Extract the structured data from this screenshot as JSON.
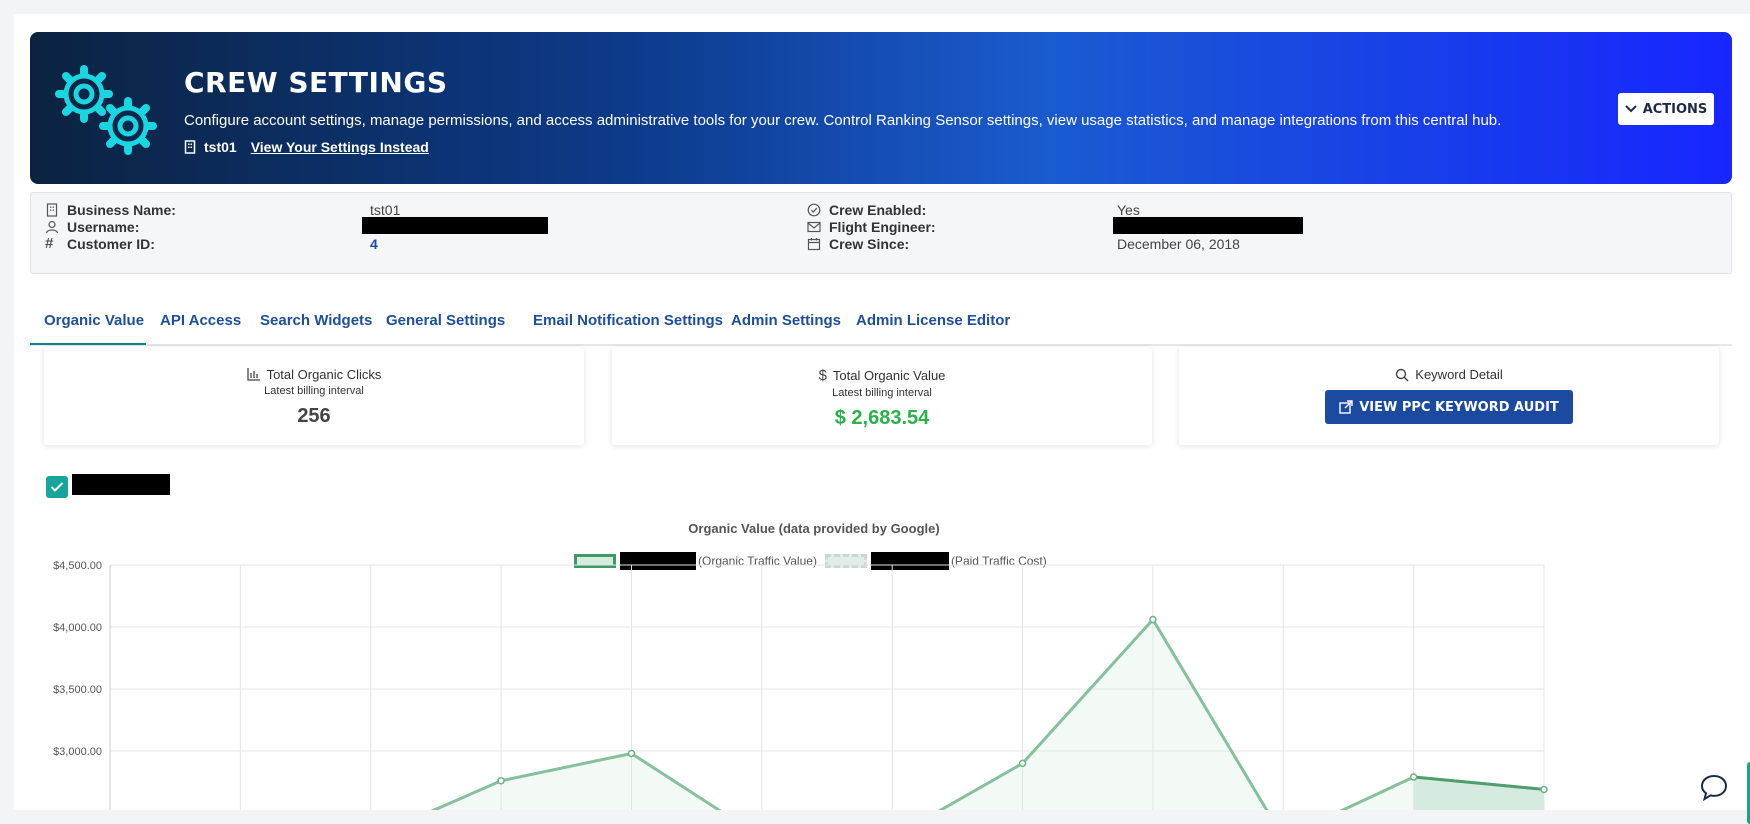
{
  "banner": {
    "title": "CREW SETTINGS",
    "description": "Configure account settings, manage permissions, and access administrative tools for your crew. Control Ranking Sensor settings, view usage statistics, and manage integrations from this central hub.",
    "crew_name": "tst01",
    "view_link": "View Your Settings Instead",
    "actions_label": "ACTIONS"
  },
  "info": {
    "business_name_label": "Business Name:",
    "business_name": "tst01",
    "username_label": "Username:",
    "customer_id_label": "Customer ID:",
    "customer_id": "4",
    "crew_enabled_label": "Crew Enabled:",
    "crew_enabled": "Yes",
    "flight_engineer_label": "Flight Engineer:",
    "crew_since_label": "Crew Since:",
    "crew_since": "December 06, 2018"
  },
  "tabs": [
    {
      "label": "Organic Value",
      "active": true
    },
    {
      "label": "API Access"
    },
    {
      "label": "Search Widgets"
    },
    {
      "label": "General Settings"
    },
    {
      "label": "Email Notification Settings"
    },
    {
      "label": "Admin Settings"
    },
    {
      "label": "Admin License Editor"
    }
  ],
  "cards": {
    "clicks": {
      "title": "Total Organic Clicks",
      "sub": "Latest billing interval",
      "value": "256"
    },
    "value": {
      "title": "Total Organic Value",
      "sub": "Latest billing interval",
      "value": "$ 2,683.54"
    },
    "keyword": {
      "title": "Keyword Detail",
      "button": "VIEW PPC KEYWORD AUDIT"
    }
  },
  "chart_data": {
    "type": "line",
    "title": "Organic Value (data provided by Google)",
    "series": [
      {
        "name": "(Organic Traffic Value)",
        "values": [
          null,
          null,
          null,
          2760,
          2980,
          null,
          null,
          2900,
          4060,
          null,
          2790,
          2690
        ]
      },
      {
        "name": "(Paid Traffic Cost)",
        "values": []
      }
    ],
    "y_ticks": [
      "$4,500.00",
      "$4,000.00",
      "$3,500.00",
      "$3,000.00"
    ],
    "ylim": [
      3000,
      4500
    ],
    "grid": true
  },
  "colors": {
    "accent": "#1c4aa0",
    "green": "#27b24a",
    "line": "#86c09c"
  }
}
